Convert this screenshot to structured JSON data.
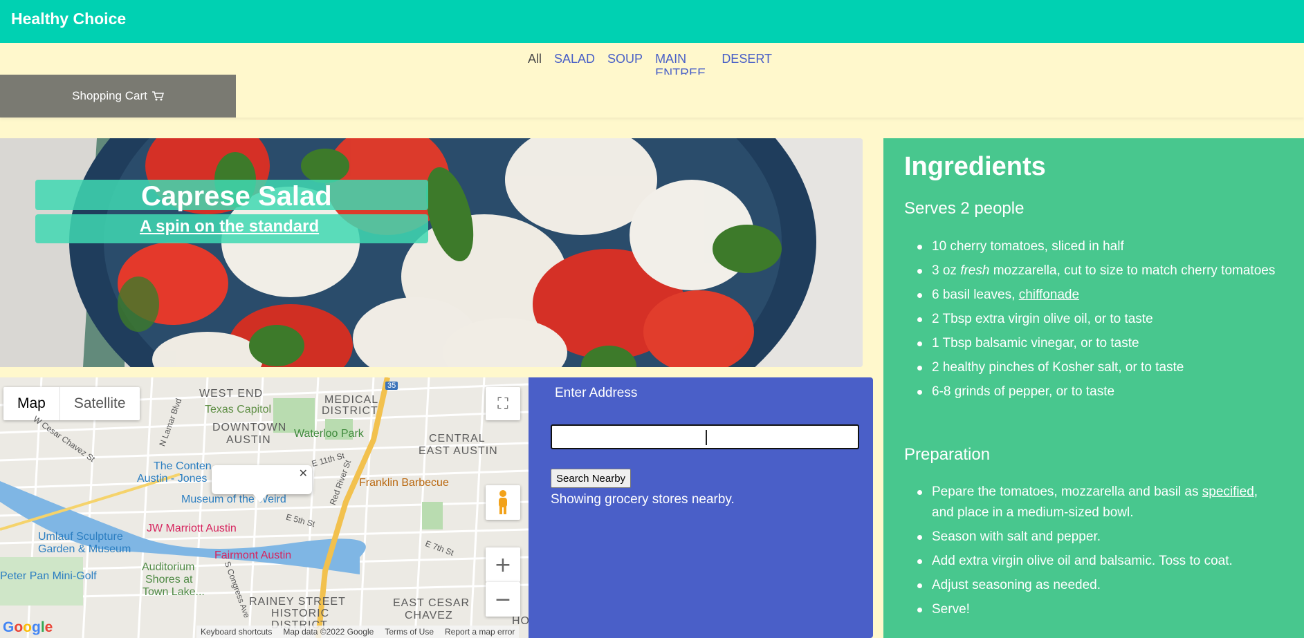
{
  "brand": "Healthy Choice",
  "tabs": [
    {
      "label": "All",
      "active": true
    },
    {
      "label": "SALAD"
    },
    {
      "label": "SOUP"
    },
    {
      "label": "MAIN ENTREE"
    },
    {
      "label": "DESERT"
    }
  ],
  "cart": {
    "label": "Shopping Cart",
    "icon": "cart-icon"
  },
  "hero": {
    "title": "Caprese Salad",
    "subtitle": "A spin on the standard"
  },
  "map": {
    "type_map": "Map",
    "type_satellite": "Satellite",
    "labels": [
      "WEST END",
      "MEDICAL",
      "DISTRICT",
      "DOWNTOWN",
      "AUSTIN",
      "CENTRAL",
      "EAST AUSTIN",
      "RAINEY STREET",
      "HISTORIC",
      "DISTRICT",
      "EAST CESAR",
      "CHAVEZ",
      "HOL"
    ],
    "pois": {
      "texas_capitol": "Texas Capitol",
      "waterloo": "Waterloo Park",
      "franklin": "Franklin Barbecue",
      "contemporary_1": "The Conten",
      "contemporary_2": "Austin - Jones",
      "museum": "Museum of the Weird",
      "jw": "JW Marriott Austin",
      "fairmont": "Fairmont Austin",
      "umlauf_1": "Umlauf Sculpture",
      "umlauf_2": "Garden & Museum",
      "auditorium_1": "Auditorium",
      "auditorium_2": "Shores at",
      "auditorium_3": "Town Lake...",
      "peterpan": "Peter Pan Mini-Golf"
    },
    "streets": {
      "w_cesar": "W Cesar Chavez St",
      "n_lamar": "N Lamar Blvd",
      "e11": "E 11th St",
      "red_river": "Red River St",
      "e5": "E 5th St",
      "e7": "E 7th St",
      "congress": "S Congress Ave",
      "i35": "35"
    },
    "google": "Google",
    "attribution": {
      "shortcuts": "Keyboard shortcuts",
      "data": "Map data ©2022 Google",
      "terms": "Terms of Use",
      "report": "Report a map error"
    }
  },
  "search": {
    "label": "Enter Address",
    "value": "",
    "button": "Search Nearby",
    "status": "Showing grocery stores nearby."
  },
  "recipe": {
    "heading": "Ingredients",
    "serves": "Serves 2 people",
    "ingredients": {
      "i1": "10 cherry tomatoes, sliced in half",
      "i2_a": "3 oz ",
      "i2_em": "fresh",
      "i2_b": " mozzarella, cut to size to match cherry tomatoes",
      "i3_a": "6 basil leaves, ",
      "i3_link": "chiffonade",
      "i4": "2 Tbsp extra virgin olive oil, or to taste",
      "i5": "1 Tbsp balsamic vinegar, or to taste",
      "i6": "2 healthy pinches of Kosher salt, or to taste",
      "i7": "6-8 grinds of pepper, or to taste"
    },
    "prep_heading": "Preparation",
    "steps": {
      "s1_a": "Pepare the tomatoes, mozzarella and basil as ",
      "s1_link": "specified",
      "s1_b": ", and place in a medium-sized bowl.",
      "s2": "Season with salt and pepper.",
      "s3": "Add extra virgin olive oil and balsamic. Toss to coat.",
      "s4": "Adjust seasoning as needed.",
      "s5": "Serve!"
    }
  },
  "colors": {
    "topbar": "#00d1b2",
    "navbg": "#fff8cc",
    "search": "#4a5fc8",
    "ingredients": "#48c78e",
    "cart": "#7a7a72"
  }
}
